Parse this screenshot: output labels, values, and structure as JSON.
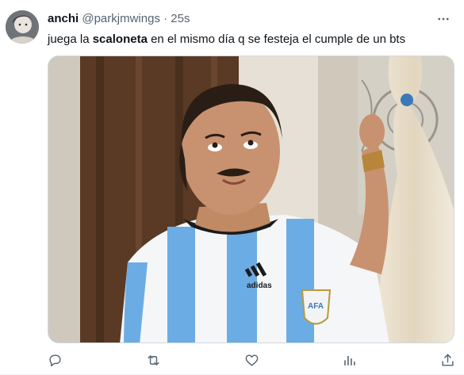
{
  "tweet": {
    "display_name": "anchi",
    "handle": "@parkjmwings",
    "separator": "·",
    "time": "25s",
    "text_before": "juega la ",
    "text_bold": "scaloneta",
    "text_after": " en el mismo día q se festeja el cumple de un bts"
  },
  "media": {
    "jersey_brand": "adidas",
    "badge_text": "AFA"
  },
  "icons": {
    "more": "more-icon",
    "reply": "reply-icon",
    "retweet": "retweet-icon",
    "like": "like-icon",
    "views": "views-icon",
    "share": "share-icon"
  },
  "colors": {
    "text": "#0f1419",
    "secondary": "#536471",
    "jersey_blue": "#6cace4"
  }
}
